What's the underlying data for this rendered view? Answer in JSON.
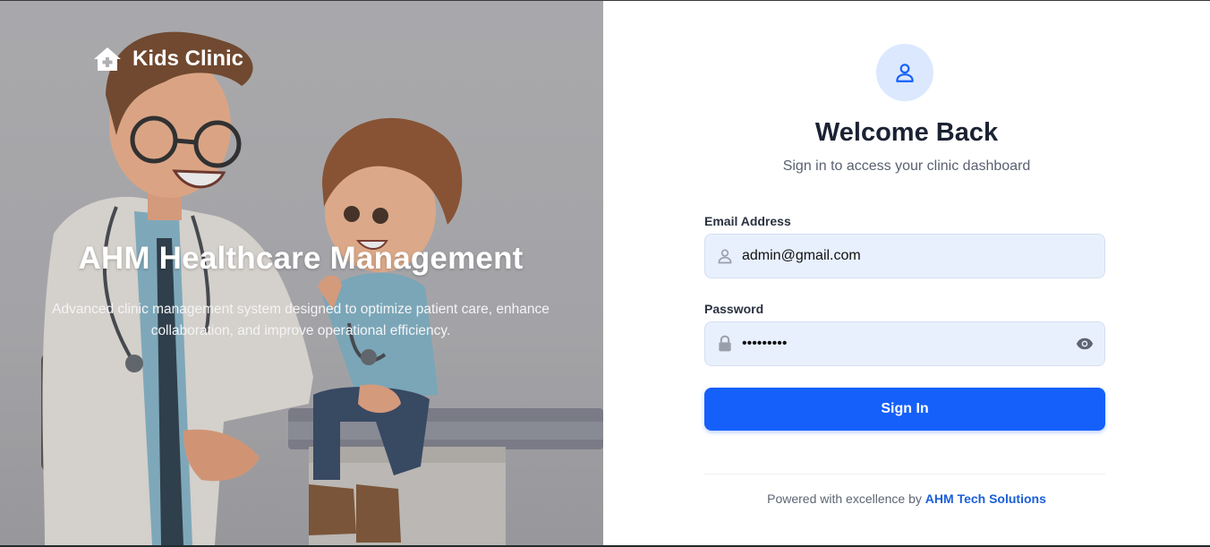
{
  "hero": {
    "brand": "Kids Clinic",
    "brand_icon": "clinic-house-icon",
    "title": "AHM Healthcare Management",
    "subtitle": "Advanced clinic management system designed to optimize patient care, enhance collaboration, and improve operational efficiency."
  },
  "login": {
    "avatar_icon": "user-icon",
    "heading": "Welcome Back",
    "subheading": "Sign in to access your clinic dashboard",
    "email": {
      "label": "Email Address",
      "value": "admin@gmail.com",
      "icon": "user-icon"
    },
    "password": {
      "label": "Password",
      "value": "password1",
      "icon": "lock-icon",
      "toggle_icon": "eye-icon"
    },
    "submit_label": "Sign In",
    "footer_text": "Powered with excellence by",
    "footer_link": "AHM Tech Solutions"
  },
  "colors": {
    "primary": "#1560fb",
    "heading": "#1a2233",
    "field_bg": "#e8f0fe",
    "avatar_bg": "#dbe8fe",
    "link": "#1a5fd6"
  }
}
